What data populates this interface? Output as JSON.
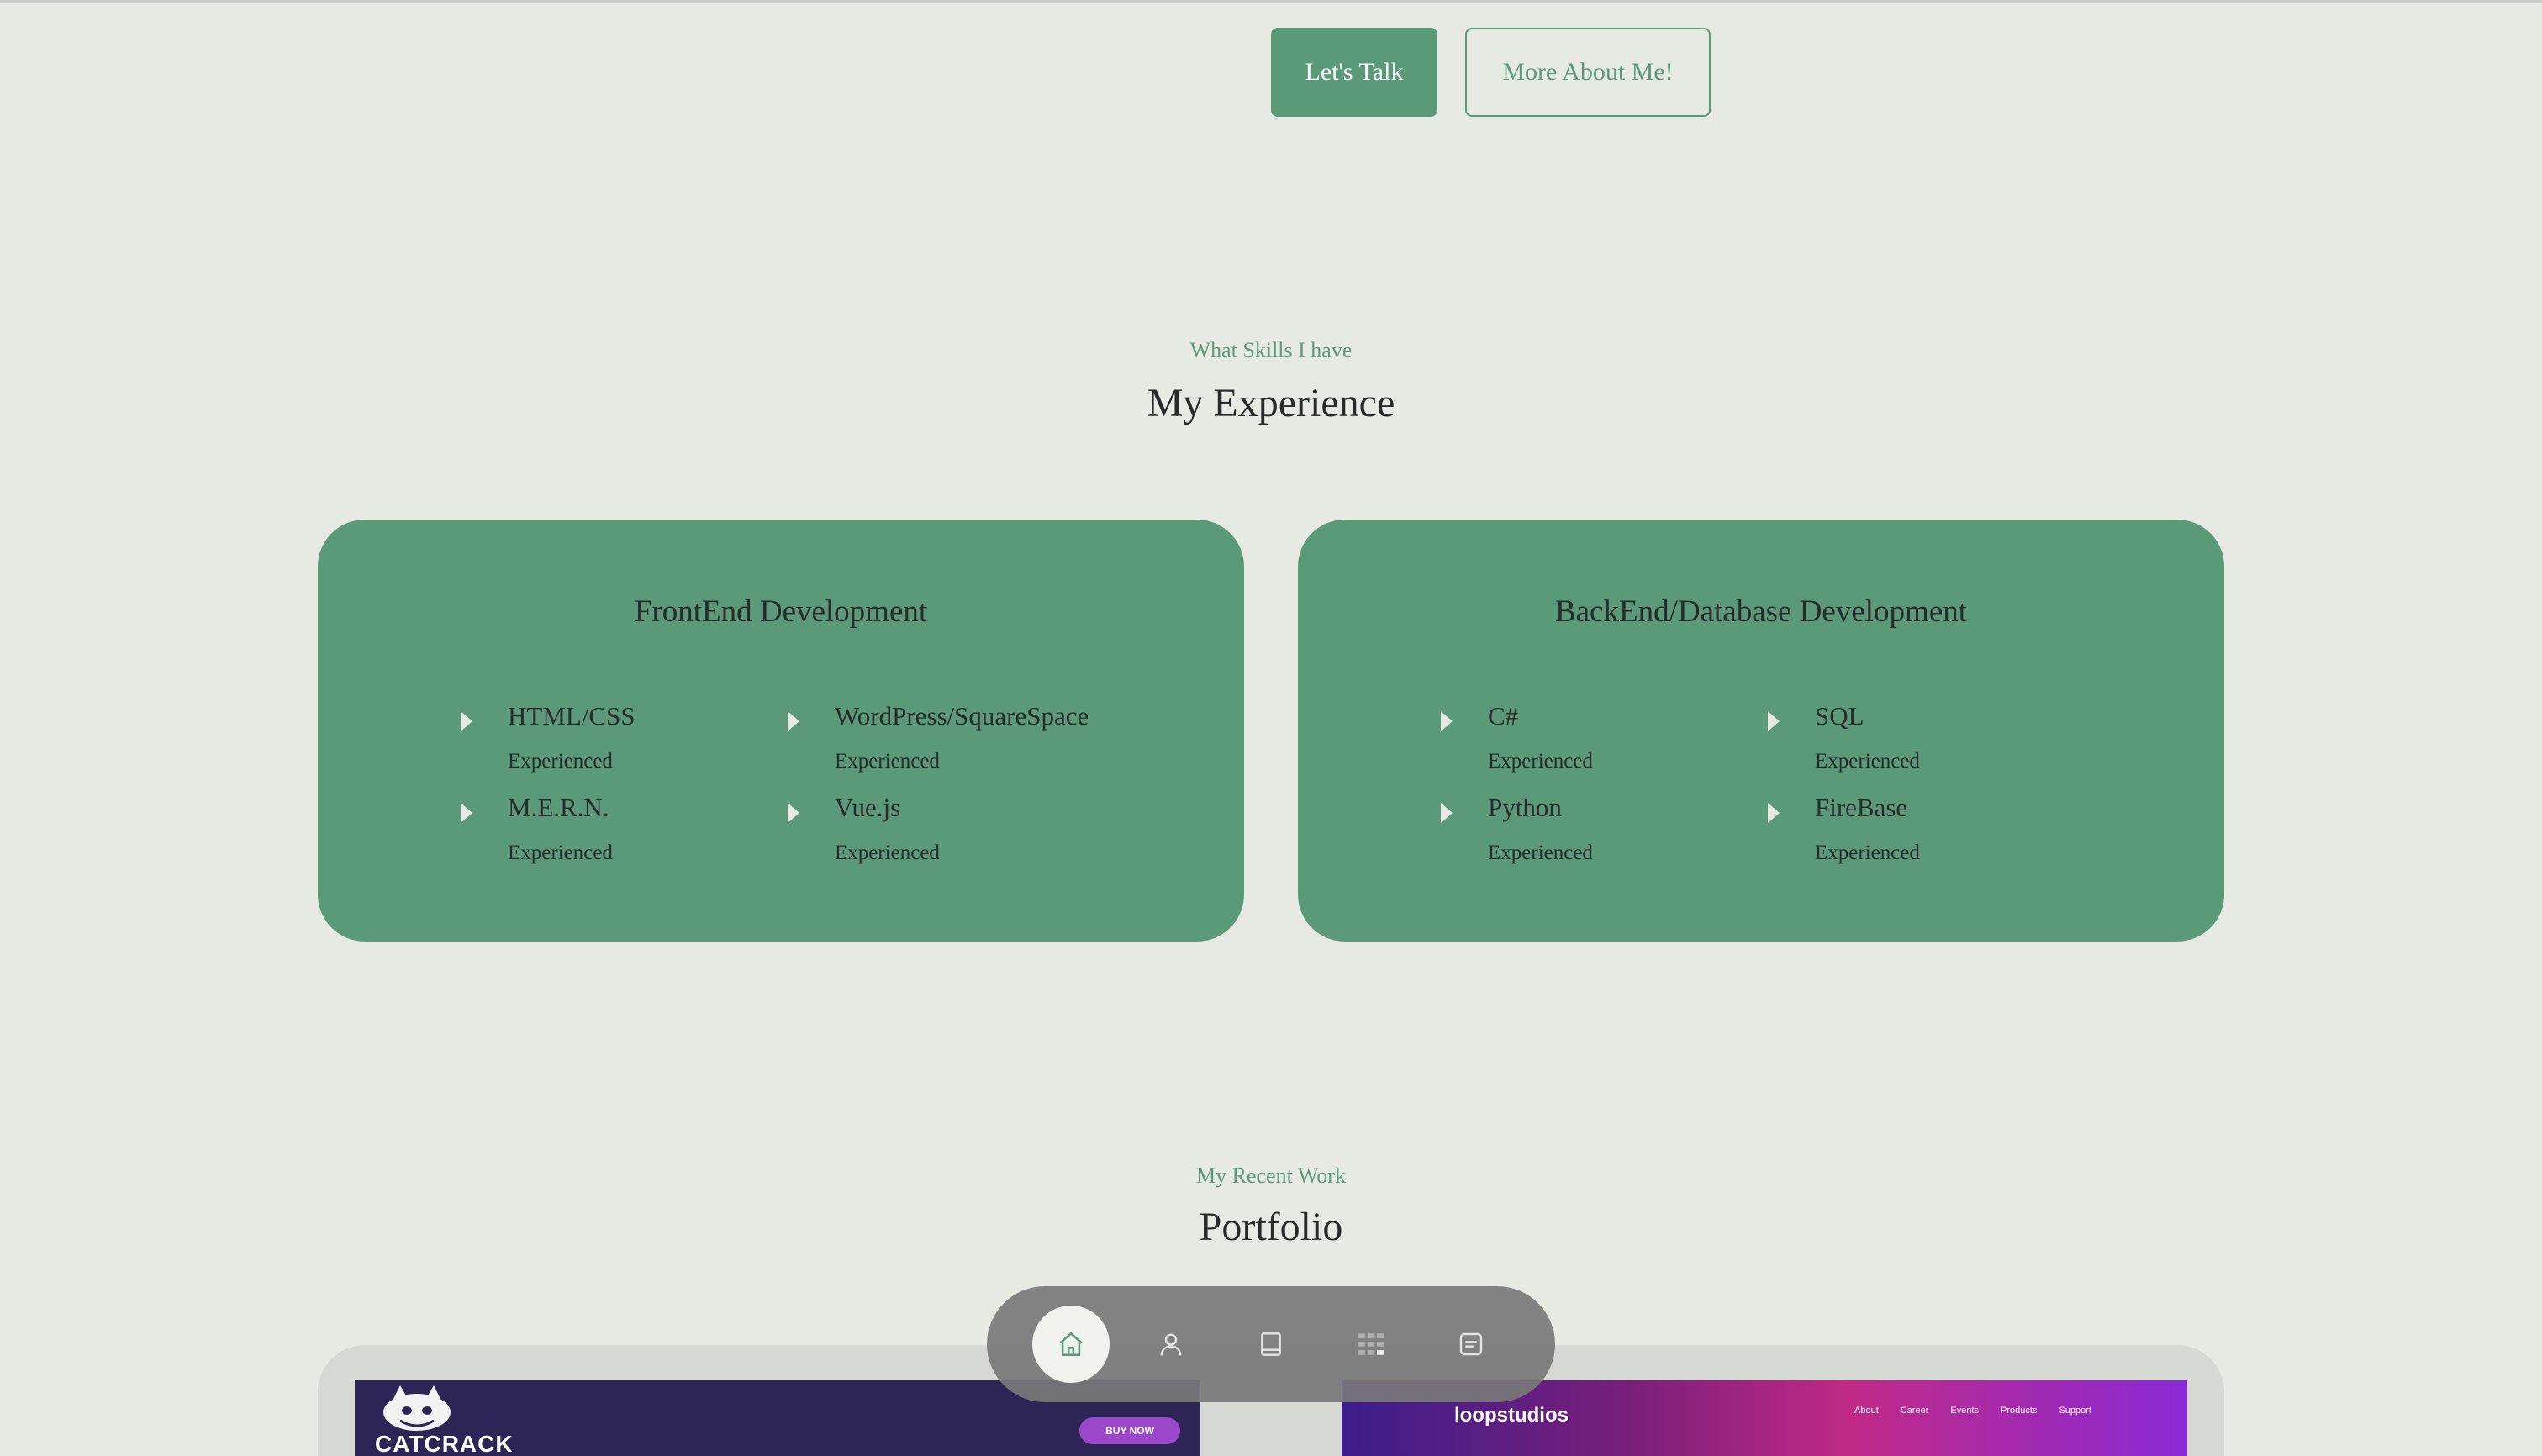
{
  "hero": {
    "primary_button": "Let's Talk",
    "secondary_button": "More About Me!"
  },
  "experience": {
    "subtitle": "What Skills I have",
    "title": "My Experience",
    "cards": [
      {
        "title": "FrontEnd Development",
        "skills": [
          {
            "name": "HTML/CSS",
            "level": "Experienced"
          },
          {
            "name": "WordPress/SquareSpace",
            "level": "Experienced"
          },
          {
            "name": "M.E.R.N.",
            "level": "Experienced"
          },
          {
            "name": "Vue.js",
            "level": "Experienced"
          }
        ]
      },
      {
        "title": "BackEnd/Database Development",
        "skills": [
          {
            "name": "C#",
            "level": "Experienced"
          },
          {
            "name": "SQL",
            "level": "Experienced"
          },
          {
            "name": "Python",
            "level": "Experienced"
          },
          {
            "name": "FireBase",
            "level": "Experienced"
          }
        ]
      }
    ]
  },
  "portfolio": {
    "subtitle": "My Recent Work",
    "title": "Portfolio",
    "items": [
      {
        "brand": "CATCRACK",
        "button": "BUY NOW"
      },
      {
        "brand": "loopstudios",
        "nav": [
          "About",
          "Career",
          "Events",
          "Products",
          "Support"
        ]
      }
    ]
  },
  "dock": {
    "items": [
      {
        "icon": "home-icon",
        "active": true
      },
      {
        "icon": "user-icon",
        "active": false
      },
      {
        "icon": "book-icon",
        "active": false
      },
      {
        "icon": "grid-icon",
        "active": false
      },
      {
        "icon": "message-icon",
        "active": false
      }
    ]
  },
  "colors": {
    "background": "#e7e9e3",
    "accent": "#5b9a79",
    "dock": "#787878"
  }
}
